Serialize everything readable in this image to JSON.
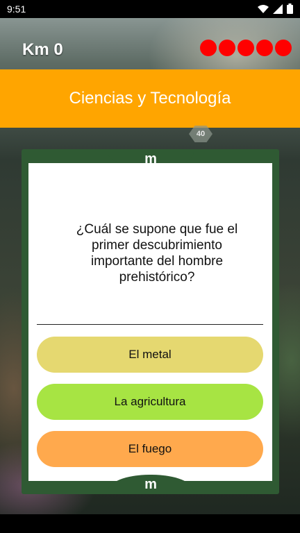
{
  "status_bar": {
    "time": "9:51",
    "icons": [
      "wifi-icon",
      "signal-icon",
      "battery-icon"
    ]
  },
  "hud": {
    "km_label": "Km 0",
    "lives_count": 5,
    "life_color": "#ff0000"
  },
  "category": {
    "title": "Ciencias y Tecnología",
    "color": "#ffa500"
  },
  "background_badge": "40",
  "card": {
    "logo": "m",
    "question": "¿Cuál se supone que fue el primer descubrimiento importante del hombre prehistórico?",
    "answers": [
      {
        "label": "El metal",
        "color": "#e5d870"
      },
      {
        "label": "La agricultura",
        "color": "#a7e443"
      },
      {
        "label": "El fuego",
        "color": "#ffa94d"
      }
    ]
  }
}
